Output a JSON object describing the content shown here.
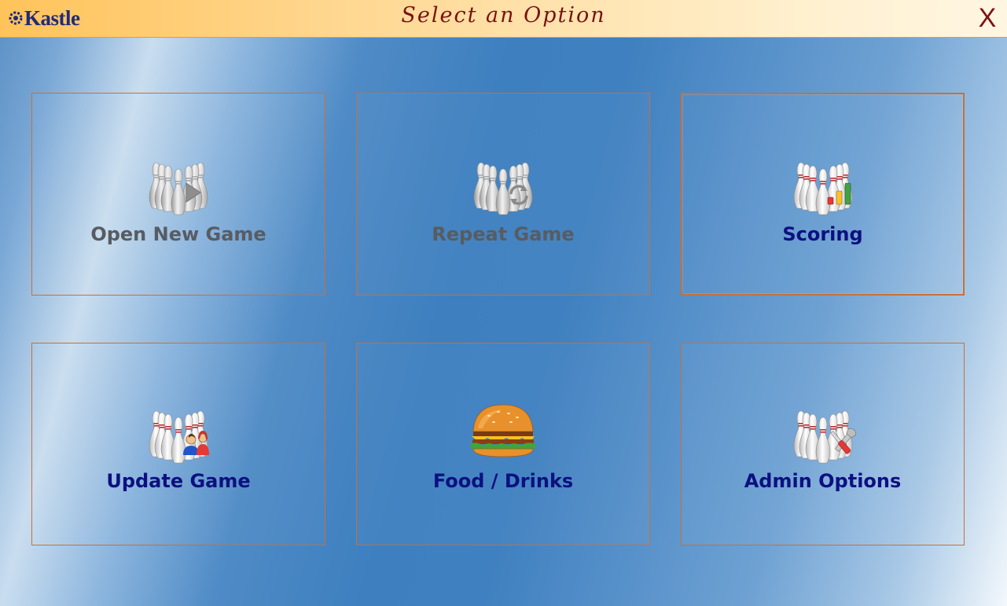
{
  "window": {
    "logo_text": "Kastle",
    "title": "Select an Option",
    "close_label": "X"
  },
  "options": [
    {
      "label": "Open New Game",
      "icon": "bowling-pins-play-icon",
      "enabled": false
    },
    {
      "label": "Repeat Game",
      "icon": "bowling-pins-repeat-icon",
      "enabled": false
    },
    {
      "label": "Scoring",
      "icon": "bowling-pins-chart-icon",
      "enabled": true,
      "selected": true
    },
    {
      "label": "Update Game",
      "icon": "bowling-pins-users-icon",
      "enabled": true
    },
    {
      "label": "Food / Drinks",
      "icon": "burger-icon",
      "enabled": true
    },
    {
      "label": "Admin Options",
      "icon": "bowling-pins-tools-icon",
      "enabled": true
    }
  ],
  "colors": {
    "title_text": "#7a1212",
    "label_enabled": "#0c1080",
    "label_disabled": "#585c62",
    "tile_border": "#c6703a"
  }
}
